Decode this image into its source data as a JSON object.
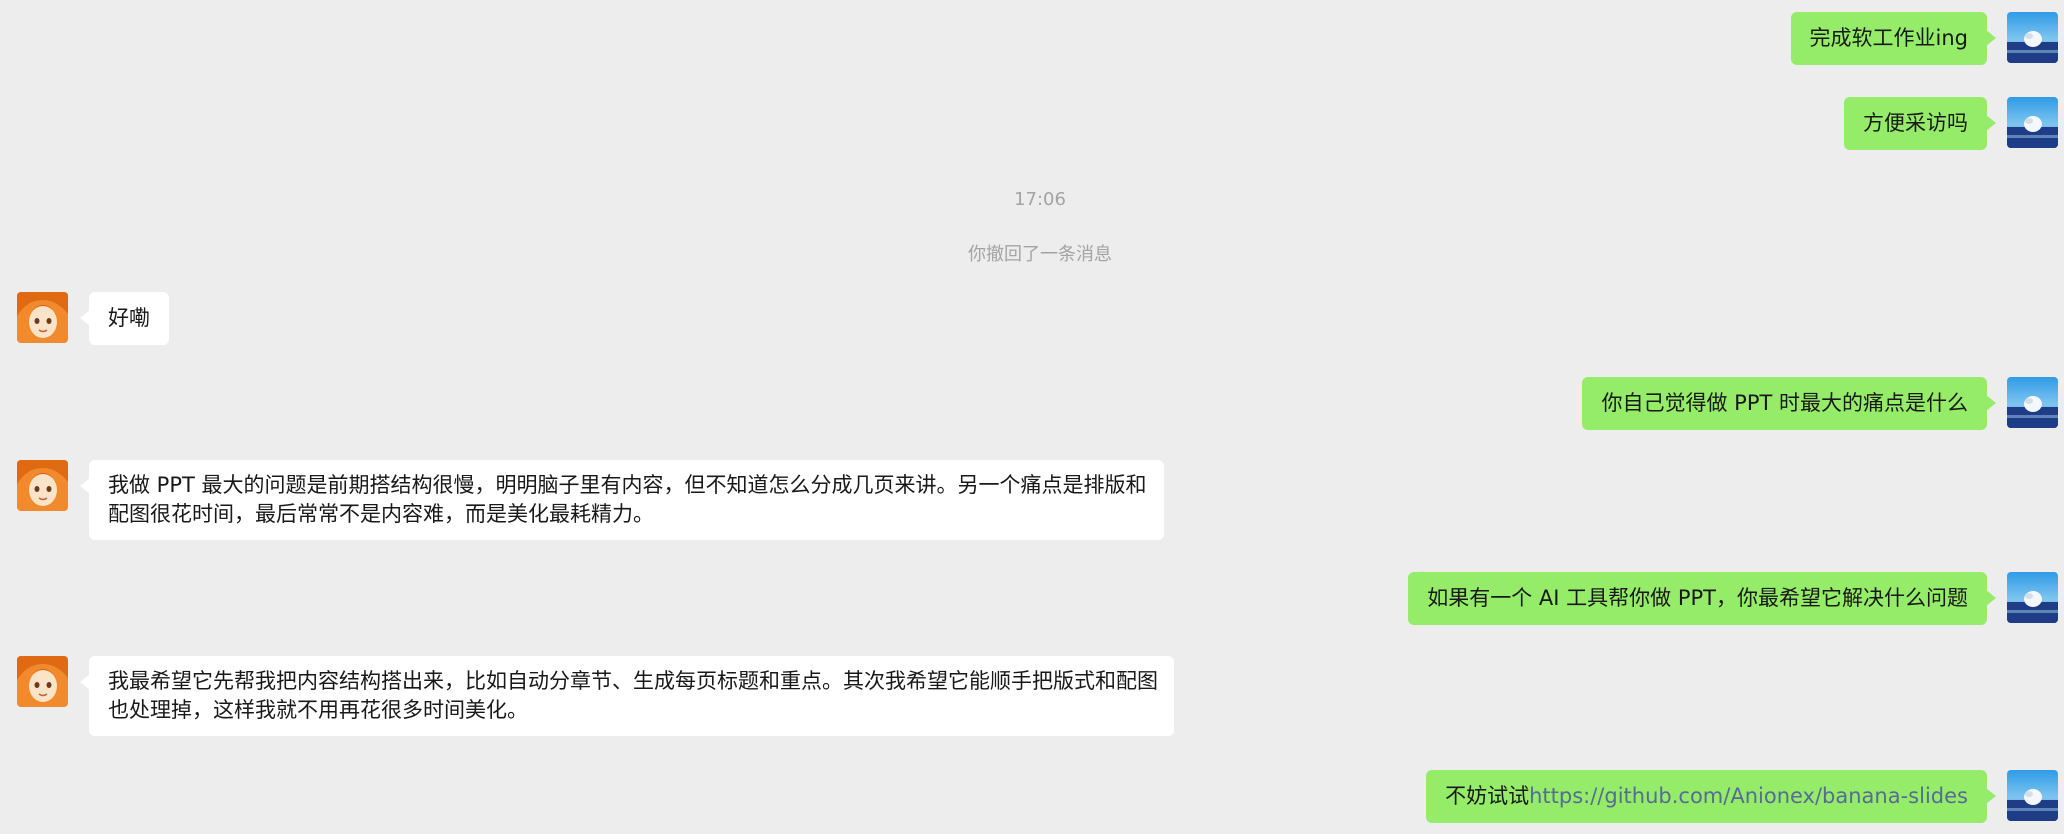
{
  "messages": {
    "m1": "完成软工作业ing",
    "m2": "方便采访吗",
    "time": "17:06",
    "recall_notice": "你撤回了一条消息",
    "m3": "好嘞",
    "m4": "你自己觉得做 PPT 时最大的痛点是什么",
    "m5_line1": "我做 PPT 最大的问题是前期搭结构很慢，明明脑子里有内容，但不知道怎么分成几页来讲。另一个痛点是排版和",
    "m5_line2": "配图很花时间，最后常常不是内容难，而是美化最耗精力。",
    "m6": "如果有一个 AI 工具帮你做 PPT，你最希望它解决什么问题",
    "m7_line1": "我最希望它先帮我把内容结构搭出来，比如自动分章节、生成每页标题和重点。其次我希望它能顺手把版式和配图",
    "m7_line2": "也处理掉，这样我就不用再花很多时间美化。",
    "m8_prefix": "不妨试试",
    "m8_link": "https://github.com/Anionex/banana-slides"
  },
  "avatars": {
    "self": "ocean-landscape-avatar",
    "peer": "anime-girl-avatar"
  },
  "colors": {
    "background": "#ededed",
    "self_bubble": "#95ec69",
    "peer_bubble": "#ffffff",
    "link": "#576b95",
    "system_text": "#a3a3a3"
  }
}
